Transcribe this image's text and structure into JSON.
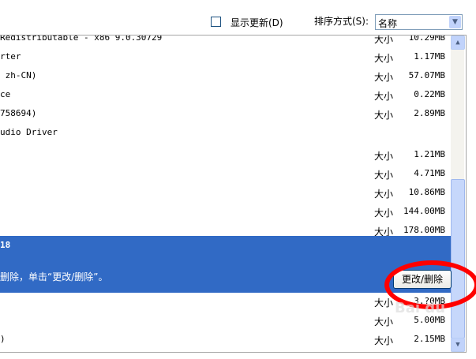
{
  "toolbar": {
    "show_updates_label": "显示更新(D)",
    "show_updates_checked": false,
    "sort_label": "排序方式(S):",
    "sort_value": "名称"
  },
  "size_label": "大小",
  "rows_top": [
    {
      "name": "Redistributable - x86 9.0.30729",
      "size": "10.29MB"
    },
    {
      "name": "rter",
      "size": "1.17MB"
    },
    {
      "name": " zh-CN)",
      "size": "57.07MB"
    },
    {
      "name": "ce",
      "size": "0.22MB"
    },
    {
      "name": "758694)",
      "size": "2.89MB"
    },
    {
      "name": "udio Driver",
      "size": ""
    },
    {
      "name": "",
      "size": "1.21MB"
    },
    {
      "name": "",
      "size": "4.71MB"
    },
    {
      "name": "",
      "size": "10.86MB"
    },
    {
      "name": "",
      "size": "144.00MB"
    },
    {
      "name": "",
      "size": "178.00MB"
    }
  ],
  "selected": {
    "title": "18",
    "description": "删除，单击“更改/删除”。",
    "button": "更改/删除"
  },
  "rows_bottom": [
    {
      "name": "",
      "size": "3.?0MB"
    },
    {
      "name": "",
      "size": "5.00MB"
    },
    {
      "name": ")",
      "size": "2.15MB"
    }
  ],
  "watermark": "Baidu经验 jingyan.baidu.com",
  "colors": {
    "selection": "#316ac5",
    "annotation": "#ff0000"
  },
  "scrollbar": {
    "position_percent": 70
  }
}
